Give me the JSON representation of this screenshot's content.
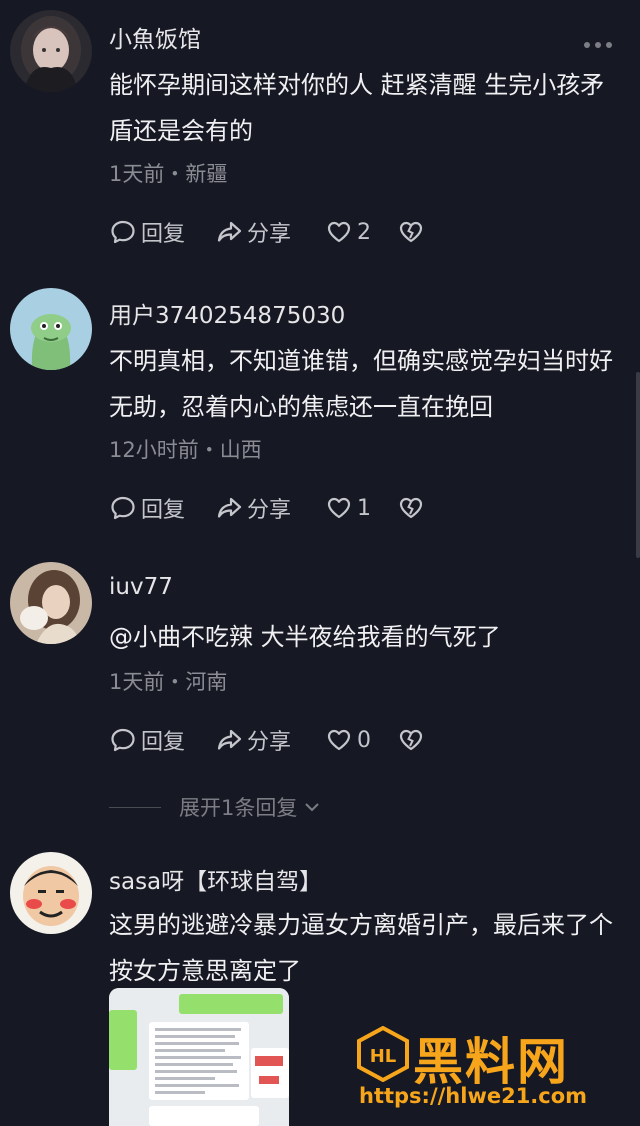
{
  "comments": [
    {
      "username": "小魚饭馆",
      "content": "能怀孕期间这样对你的人 赶紧清醒 生完小孩矛盾还是会有的",
      "meta": "1天前・新疆",
      "reply_label": "回复",
      "share_label": "分享",
      "likes": "2"
    },
    {
      "username": "用户3740254875030",
      "content": "不明真相，不知道谁错，但确实感觉孕妇当时好无助，忍着内心的焦虑还一直在挽回",
      "meta": "12小时前・山西",
      "reply_label": "回复",
      "share_label": "分享",
      "likes": "1"
    },
    {
      "username": "iuv77",
      "content": "@小曲不吃辣 大半夜给我看的气死了",
      "meta": "1天前・河南",
      "reply_label": "回复",
      "share_label": "分享",
      "likes": "0"
    },
    {
      "username": "sasa呀【环球自驾】",
      "content": "这男的逃避冷暴力逼女方离婚引产，最后来了个按女方意思离定了"
    }
  ],
  "expand_replies": "展开1条回复",
  "watermark": {
    "title": "黑料网",
    "url": "https://hlwe21.com",
    "badge": "HL"
  },
  "colors": {
    "background": "#161823",
    "accent": "#f7a51b",
    "meta_text": "#8b8c93"
  }
}
